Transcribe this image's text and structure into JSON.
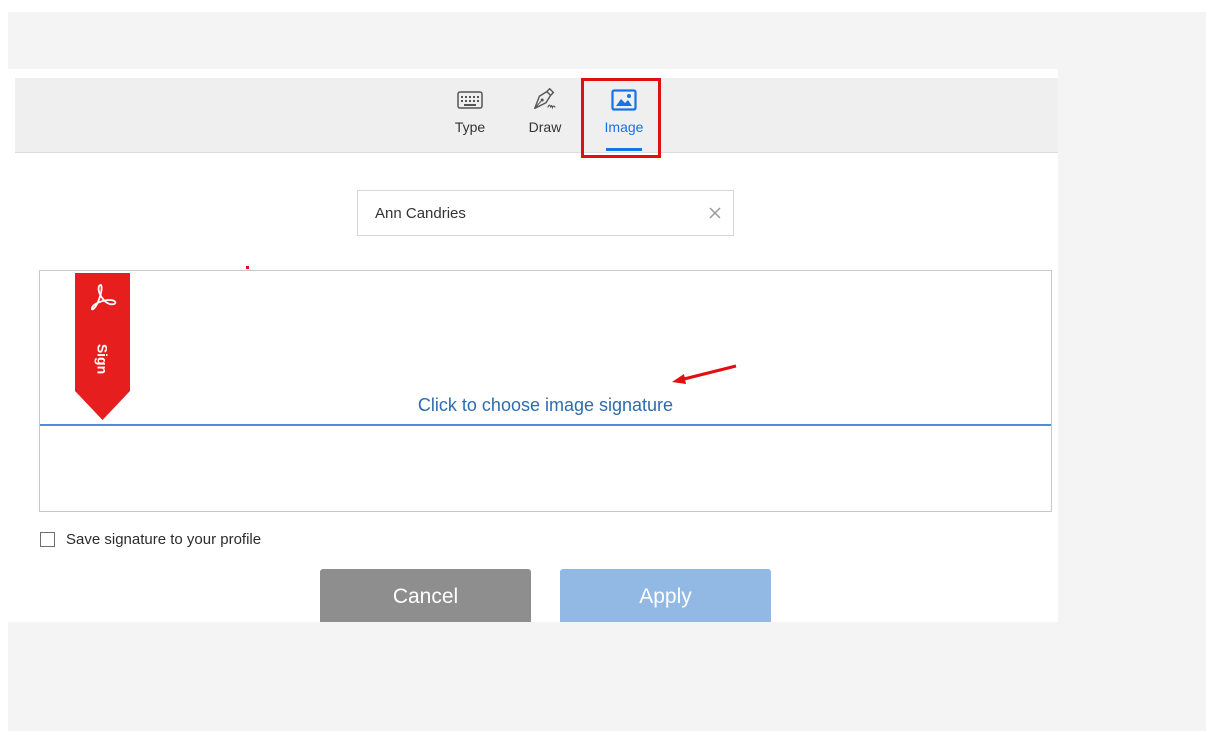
{
  "tabs": {
    "type": {
      "label": "Type",
      "icon": "keyboard-icon"
    },
    "draw": {
      "label": "Draw",
      "icon": "pen-icon"
    },
    "image": {
      "label": "Image",
      "icon": "image-icon",
      "selected": true
    }
  },
  "name_field": {
    "value": "Ann Candries",
    "clear_icon": "close-icon"
  },
  "signature_area": {
    "choose_image_label": "Click to choose image signature",
    "sign_ribbon_label": "Sign",
    "sign_ribbon_icon": "acrobat-logo-icon"
  },
  "save_option": {
    "label": "Save signature to your profile",
    "checked": false
  },
  "buttons": {
    "cancel": "Cancel",
    "apply": "Apply"
  },
  "colors": {
    "accent": "#1473e6",
    "highlight": "#e01010",
    "cancel_bg": "#8e8e8e",
    "apply_bg": "#92b9e3",
    "link": "#2d6cb0"
  }
}
